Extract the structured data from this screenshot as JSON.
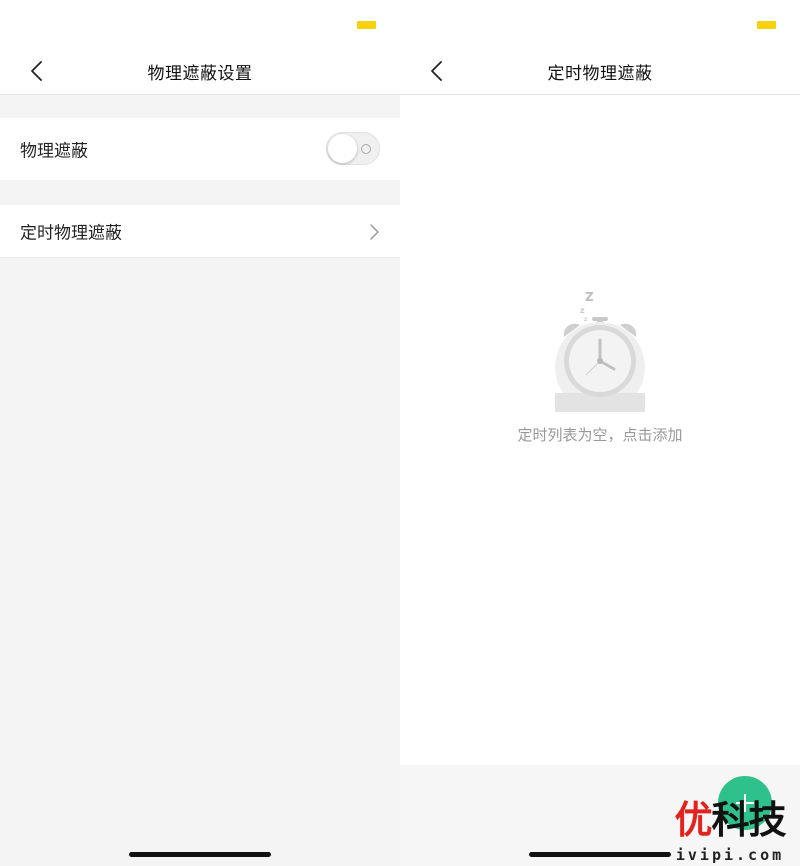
{
  "left_screen": {
    "title": "物理遮蔽设置",
    "back_icon": "chevron-left-icon",
    "rows": [
      {
        "label": "物理遮蔽",
        "control": "toggle",
        "toggle_on": false
      },
      {
        "label": "定时物理遮蔽",
        "control": "chevron-right-icon"
      }
    ]
  },
  "right_screen": {
    "title": "定时物理遮蔽",
    "back_icon": "chevron-left-icon",
    "empty_state": {
      "icon": "alarm-clock-sleep-icon",
      "text": "定时列表为空，点击添加"
    },
    "add_button_icon": "plus-icon"
  },
  "status_bar": {
    "battery_color": "#f5d20a"
  },
  "colors": {
    "accent": "#2fc18b",
    "background": "#f4f4f4",
    "text_secondary": "#999999"
  },
  "watermark": {
    "main_a": "优",
    "main_b": "科技",
    "sub": "ivipi.com"
  }
}
